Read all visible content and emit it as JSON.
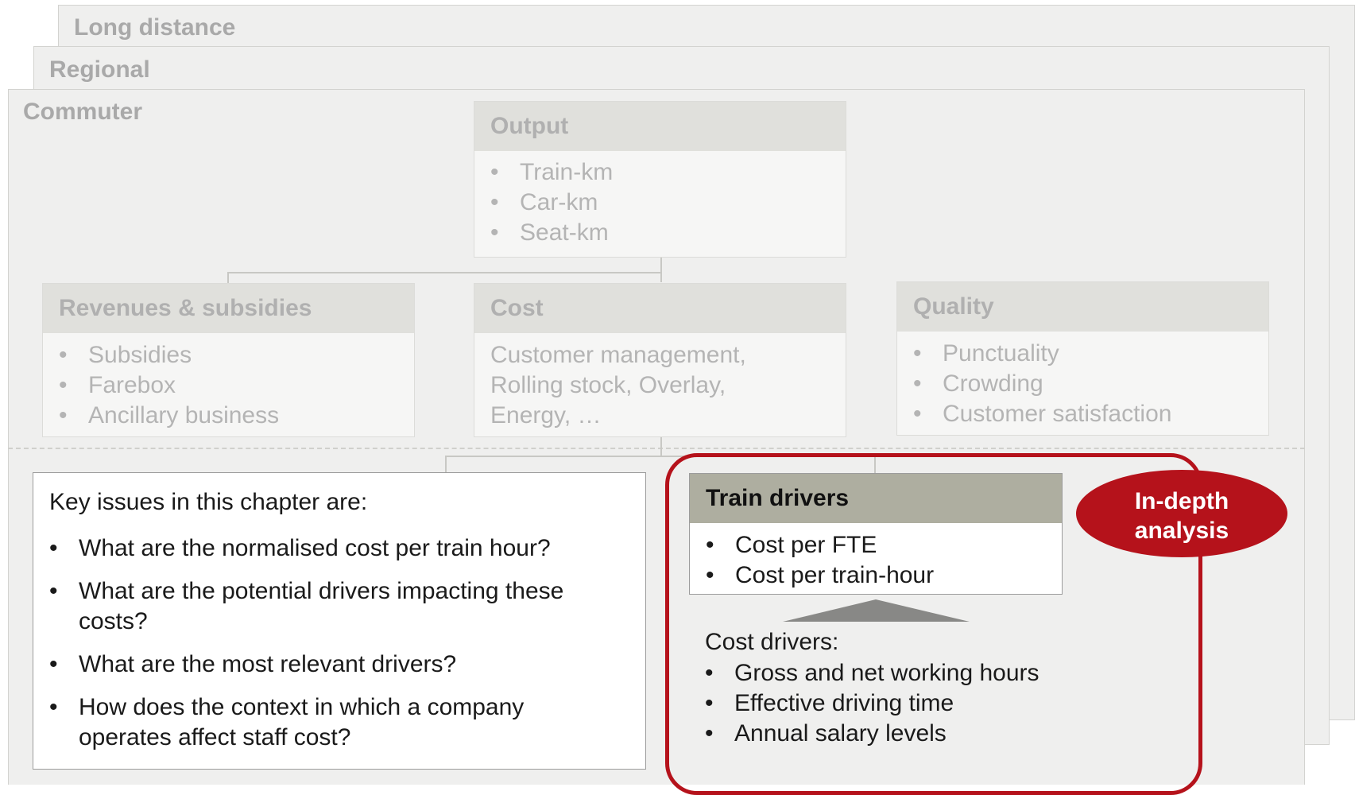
{
  "layers": {
    "long_distance": "Long distance",
    "regional": "Regional",
    "commuter": "Commuter"
  },
  "output": {
    "title": "Output",
    "items": [
      "Train-km",
      "Car-km",
      "Seat-km"
    ]
  },
  "revenues": {
    "title": "Revenues & subsidies",
    "items": [
      "Subsidies",
      "Farebox",
      "Ancillary business"
    ]
  },
  "cost": {
    "title": "Cost",
    "lines": [
      "Customer management,",
      "Rolling stock, Overlay,",
      "Energy, …"
    ]
  },
  "quality": {
    "title": "Quality",
    "items": [
      "Punctuality",
      "Crowding",
      "Customer satisfaction"
    ]
  },
  "key_issues": {
    "heading": "Key issues in this chapter are:",
    "items": [
      [
        "What are the normalised cost per train hour?"
      ],
      [
        "What are the potential drivers impacting these",
        "costs?"
      ],
      [
        "What are the most relevant drivers?"
      ],
      [
        "How does the context in which a company",
        "operates affect staff cost?"
      ]
    ]
  },
  "train_drivers": {
    "title": "Train drivers",
    "items": [
      "Cost per FTE",
      "Cost per train-hour"
    ]
  },
  "cost_drivers": {
    "heading": "Cost drivers:",
    "items": [
      "Gross and net working hours",
      "Effective driving time",
      "Annual salary levels"
    ]
  },
  "badge": {
    "line1": "In-depth",
    "line2": "analysis"
  },
  "colors": {
    "accent_red": "#b5121b",
    "layer_bg": "#efefee",
    "header_gray": "#aeaea0"
  }
}
